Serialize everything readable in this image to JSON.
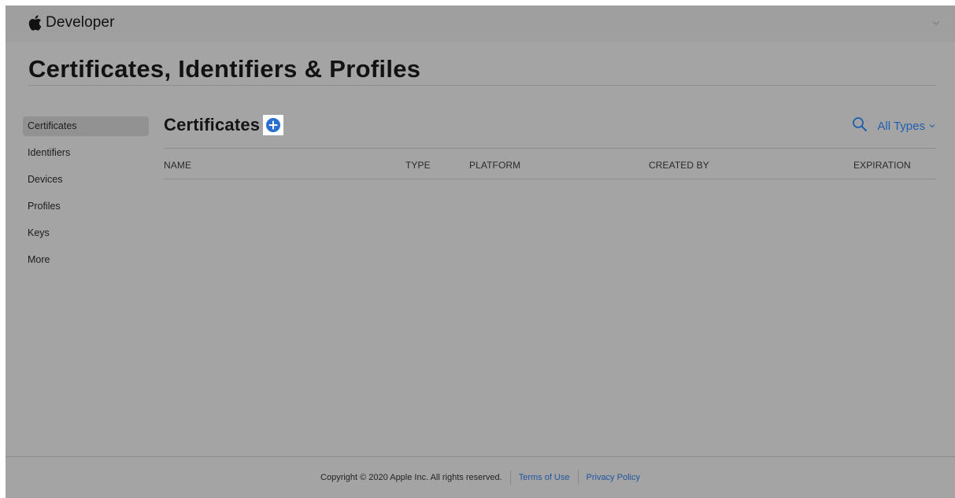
{
  "header": {
    "brand_label": "Developer",
    "icons": [
      "apple-logo-icon",
      "chevron-down-icon"
    ]
  },
  "page": {
    "title": "Certificates, Identifiers & Profiles"
  },
  "sidebar": {
    "items": [
      {
        "label": "Certificates",
        "active": true
      },
      {
        "label": "Identifiers",
        "active": false
      },
      {
        "label": "Devices",
        "active": false
      },
      {
        "label": "Profiles",
        "active": false
      },
      {
        "label": "Keys",
        "active": false
      },
      {
        "label": "More",
        "active": false
      }
    ]
  },
  "main": {
    "section_title": "Certificates",
    "add_icon": "plus-circle-icon",
    "search_icon": "search-icon",
    "filter_selected": "All Types",
    "columns": [
      "NAME",
      "TYPE",
      "PLATFORM",
      "CREATED BY",
      "EXPIRATION"
    ],
    "rows": []
  },
  "footer": {
    "copyright": "Copyright © 2020 Apple Inc. All rights reserved.",
    "terms_label": "Terms of Use",
    "privacy_label": "Privacy Policy"
  },
  "colors": {
    "accent": "#2a6fcf",
    "link": "#1f56a0",
    "overlay_background": "#a4a4a4"
  }
}
